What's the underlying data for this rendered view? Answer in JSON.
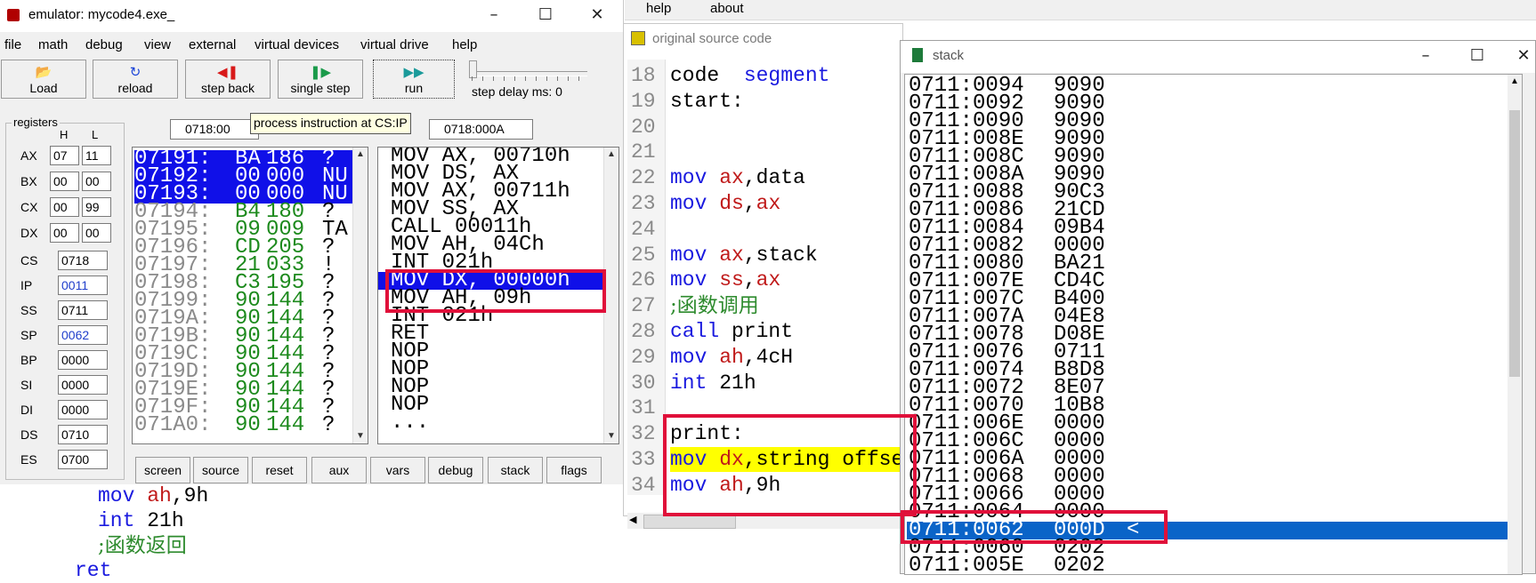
{
  "emulator": {
    "title": "emulator: mycode4.exe_",
    "menu": [
      "file",
      "math",
      "debug",
      "view",
      "external",
      "virtual devices",
      "virtual drive",
      "help"
    ],
    "toolbar": {
      "load": "Load",
      "reload": "reload",
      "step_back": "step back",
      "single_step": "single step",
      "run": "run",
      "step_delay": "step delay ms: 0"
    },
    "registers_caption": "registers",
    "reg_h": "H",
    "reg_l": "L",
    "regs8": [
      {
        "name": "AX",
        "h": "07",
        "l": "11"
      },
      {
        "name": "BX",
        "h": "00",
        "l": "00"
      },
      {
        "name": "CX",
        "h": "00",
        "l": "99"
      },
      {
        "name": "DX",
        "h": "00",
        "l": "00"
      }
    ],
    "regs16": [
      {
        "name": "CS",
        "value": "0718",
        "blue": false
      },
      {
        "name": "IP",
        "value": "0011",
        "blue": true
      },
      {
        "name": "SS",
        "value": "0711",
        "blue": false
      },
      {
        "name": "SP",
        "value": "0062",
        "blue": true
      },
      {
        "name": "BP",
        "value": "0000",
        "blue": false
      },
      {
        "name": "SI",
        "value": "0000",
        "blue": false
      },
      {
        "name": "DI",
        "value": "0000",
        "blue": false
      },
      {
        "name": "DS",
        "value": "0710",
        "blue": false
      },
      {
        "name": "ES",
        "value": "0700",
        "blue": false
      }
    ],
    "addr_left": "0718:00",
    "addr_right": "0718:000A",
    "tooltip": "process instruction at CS:IP",
    "memory": [
      {
        "addr": "07191:",
        "hex": "BA",
        "dec": "186",
        "ch": "?"
      },
      {
        "addr": "07192:",
        "hex": "00",
        "dec": "000",
        "ch": "NU"
      },
      {
        "addr": "07193:",
        "hex": "00",
        "dec": "000",
        "ch": "NU"
      },
      {
        "addr": "07194:",
        "hex": "B4",
        "dec": "180",
        "ch": "?"
      },
      {
        "addr": "07195:",
        "hex": "09",
        "dec": "009",
        "ch": "TA"
      },
      {
        "addr": "07196:",
        "hex": "CD",
        "dec": "205",
        "ch": "?"
      },
      {
        "addr": "07197:",
        "hex": "21",
        "dec": "033",
        "ch": "!"
      },
      {
        "addr": "07198:",
        "hex": "C3",
        "dec": "195",
        "ch": "?"
      },
      {
        "addr": "07199:",
        "hex": "90",
        "dec": "144",
        "ch": "?"
      },
      {
        "addr": "0719A:",
        "hex": "90",
        "dec": "144",
        "ch": "?"
      },
      {
        "addr": "0719B:",
        "hex": "90",
        "dec": "144",
        "ch": "?"
      },
      {
        "addr": "0719C:",
        "hex": "90",
        "dec": "144",
        "ch": "?"
      },
      {
        "addr": "0719D:",
        "hex": "90",
        "dec": "144",
        "ch": "?"
      },
      {
        "addr": "0719E:",
        "hex": "90",
        "dec": "144",
        "ch": "?"
      },
      {
        "addr": "0719F:",
        "hex": "90",
        "dec": "144",
        "ch": "?"
      },
      {
        "addr": "071A0:",
        "hex": "90",
        "dec": "144",
        "ch": "?"
      }
    ],
    "disasm": [
      "MOV AX, 00710h",
      "MOV DS, AX",
      "MOV AX, 00711h",
      "MOV SS, AX",
      "CALL 00011h",
      "MOV AH, 04Ch",
      "INT 021h",
      "MOV DX, 00000h",
      "MOV AH, 09h",
      "INT 021h",
      "RET",
      "NOP",
      "NOP",
      "NOP",
      "NOP",
      "..."
    ],
    "bottom_buttons": [
      "screen",
      "source",
      "reset",
      "aux",
      "vars",
      "debug",
      "stack",
      "flags"
    ]
  },
  "background_code": [
    {
      "kw": "mov",
      "reg": "ah",
      "rest": ",9h"
    },
    {
      "kw": "int",
      "reg": "",
      "rest": " 21h"
    },
    {
      "kw": "",
      "reg": "",
      "rest": "",
      "comment": ";函数返回"
    },
    {
      "kw": "ret",
      "reg": "",
      "rest": ""
    }
  ],
  "edit_menu": [
    "help",
    "about"
  ],
  "source_window": {
    "title": "original source code",
    "lines": [
      {
        "no": "18",
        "text": "code  segment"
      },
      {
        "no": "19",
        "text": "start:"
      },
      {
        "no": "20",
        "text": ""
      },
      {
        "no": "21",
        "text": ""
      },
      {
        "no": "22",
        "text": "mov ax,data"
      },
      {
        "no": "23",
        "text": "mov ds,ax"
      },
      {
        "no": "24",
        "text": ""
      },
      {
        "no": "25",
        "text": "mov ax,stack"
      },
      {
        "no": "26",
        "text": "mov ss,ax"
      },
      {
        "no": "27",
        "text": ";函数调用"
      },
      {
        "no": "28",
        "text": "call print"
      },
      {
        "no": "29",
        "text": "mov ah,4cH"
      },
      {
        "no": "30",
        "text": "int 21h"
      },
      {
        "no": "31",
        "text": ""
      },
      {
        "no": "32",
        "text": "print:"
      },
      {
        "no": "33",
        "text": "mov dx,string offset"
      },
      {
        "no": "34",
        "text": "mov ah,9h"
      }
    ]
  },
  "stack_window": {
    "title": "stack",
    "rows": [
      {
        "addr": "0711:0094",
        "val": "9090",
        "mark": ""
      },
      {
        "addr": "0711:0092",
        "val": "9090",
        "mark": ""
      },
      {
        "addr": "0711:0090",
        "val": "9090",
        "mark": ""
      },
      {
        "addr": "0711:008E",
        "val": "9090",
        "mark": ""
      },
      {
        "addr": "0711:008C",
        "val": "9090",
        "mark": ""
      },
      {
        "addr": "0711:008A",
        "val": "9090",
        "mark": ""
      },
      {
        "addr": "0711:0088",
        "val": "90C3",
        "mark": ""
      },
      {
        "addr": "0711:0086",
        "val": "21CD",
        "mark": ""
      },
      {
        "addr": "0711:0084",
        "val": "09B4",
        "mark": ""
      },
      {
        "addr": "0711:0082",
        "val": "0000",
        "mark": ""
      },
      {
        "addr": "0711:0080",
        "val": "BA21",
        "mark": ""
      },
      {
        "addr": "0711:007E",
        "val": "CD4C",
        "mark": ""
      },
      {
        "addr": "0711:007C",
        "val": "B400",
        "mark": ""
      },
      {
        "addr": "0711:007A",
        "val": "04E8",
        "mark": ""
      },
      {
        "addr": "0711:0078",
        "val": "D08E",
        "mark": ""
      },
      {
        "addr": "0711:0076",
        "val": "0711",
        "mark": ""
      },
      {
        "addr": "0711:0074",
        "val": "B8D8",
        "mark": ""
      },
      {
        "addr": "0711:0072",
        "val": "8E07",
        "mark": ""
      },
      {
        "addr": "0711:0070",
        "val": "10B8",
        "mark": ""
      },
      {
        "addr": "0711:006E",
        "val": "0000",
        "mark": ""
      },
      {
        "addr": "0711:006C",
        "val": "0000",
        "mark": ""
      },
      {
        "addr": "0711:006A",
        "val": "0000",
        "mark": ""
      },
      {
        "addr": "0711:0068",
        "val": "0000",
        "mark": ""
      },
      {
        "addr": "0711:0066",
        "val": "0000",
        "mark": ""
      },
      {
        "addr": "0711:0064",
        "val": "0000",
        "mark": ""
      },
      {
        "addr": "0711:0062",
        "val": "000D",
        "mark": "<"
      },
      {
        "addr": "0711:0060",
        "val": "0202",
        "mark": ""
      },
      {
        "addr": "0711:005E",
        "val": "0202",
        "mark": ""
      }
    ]
  },
  "colors": {
    "selection_blue": "#1010e8",
    "stack_selection": "#0a64c8",
    "annotation_red": "#e0103a",
    "highlight_yellow": "#ffff00"
  }
}
